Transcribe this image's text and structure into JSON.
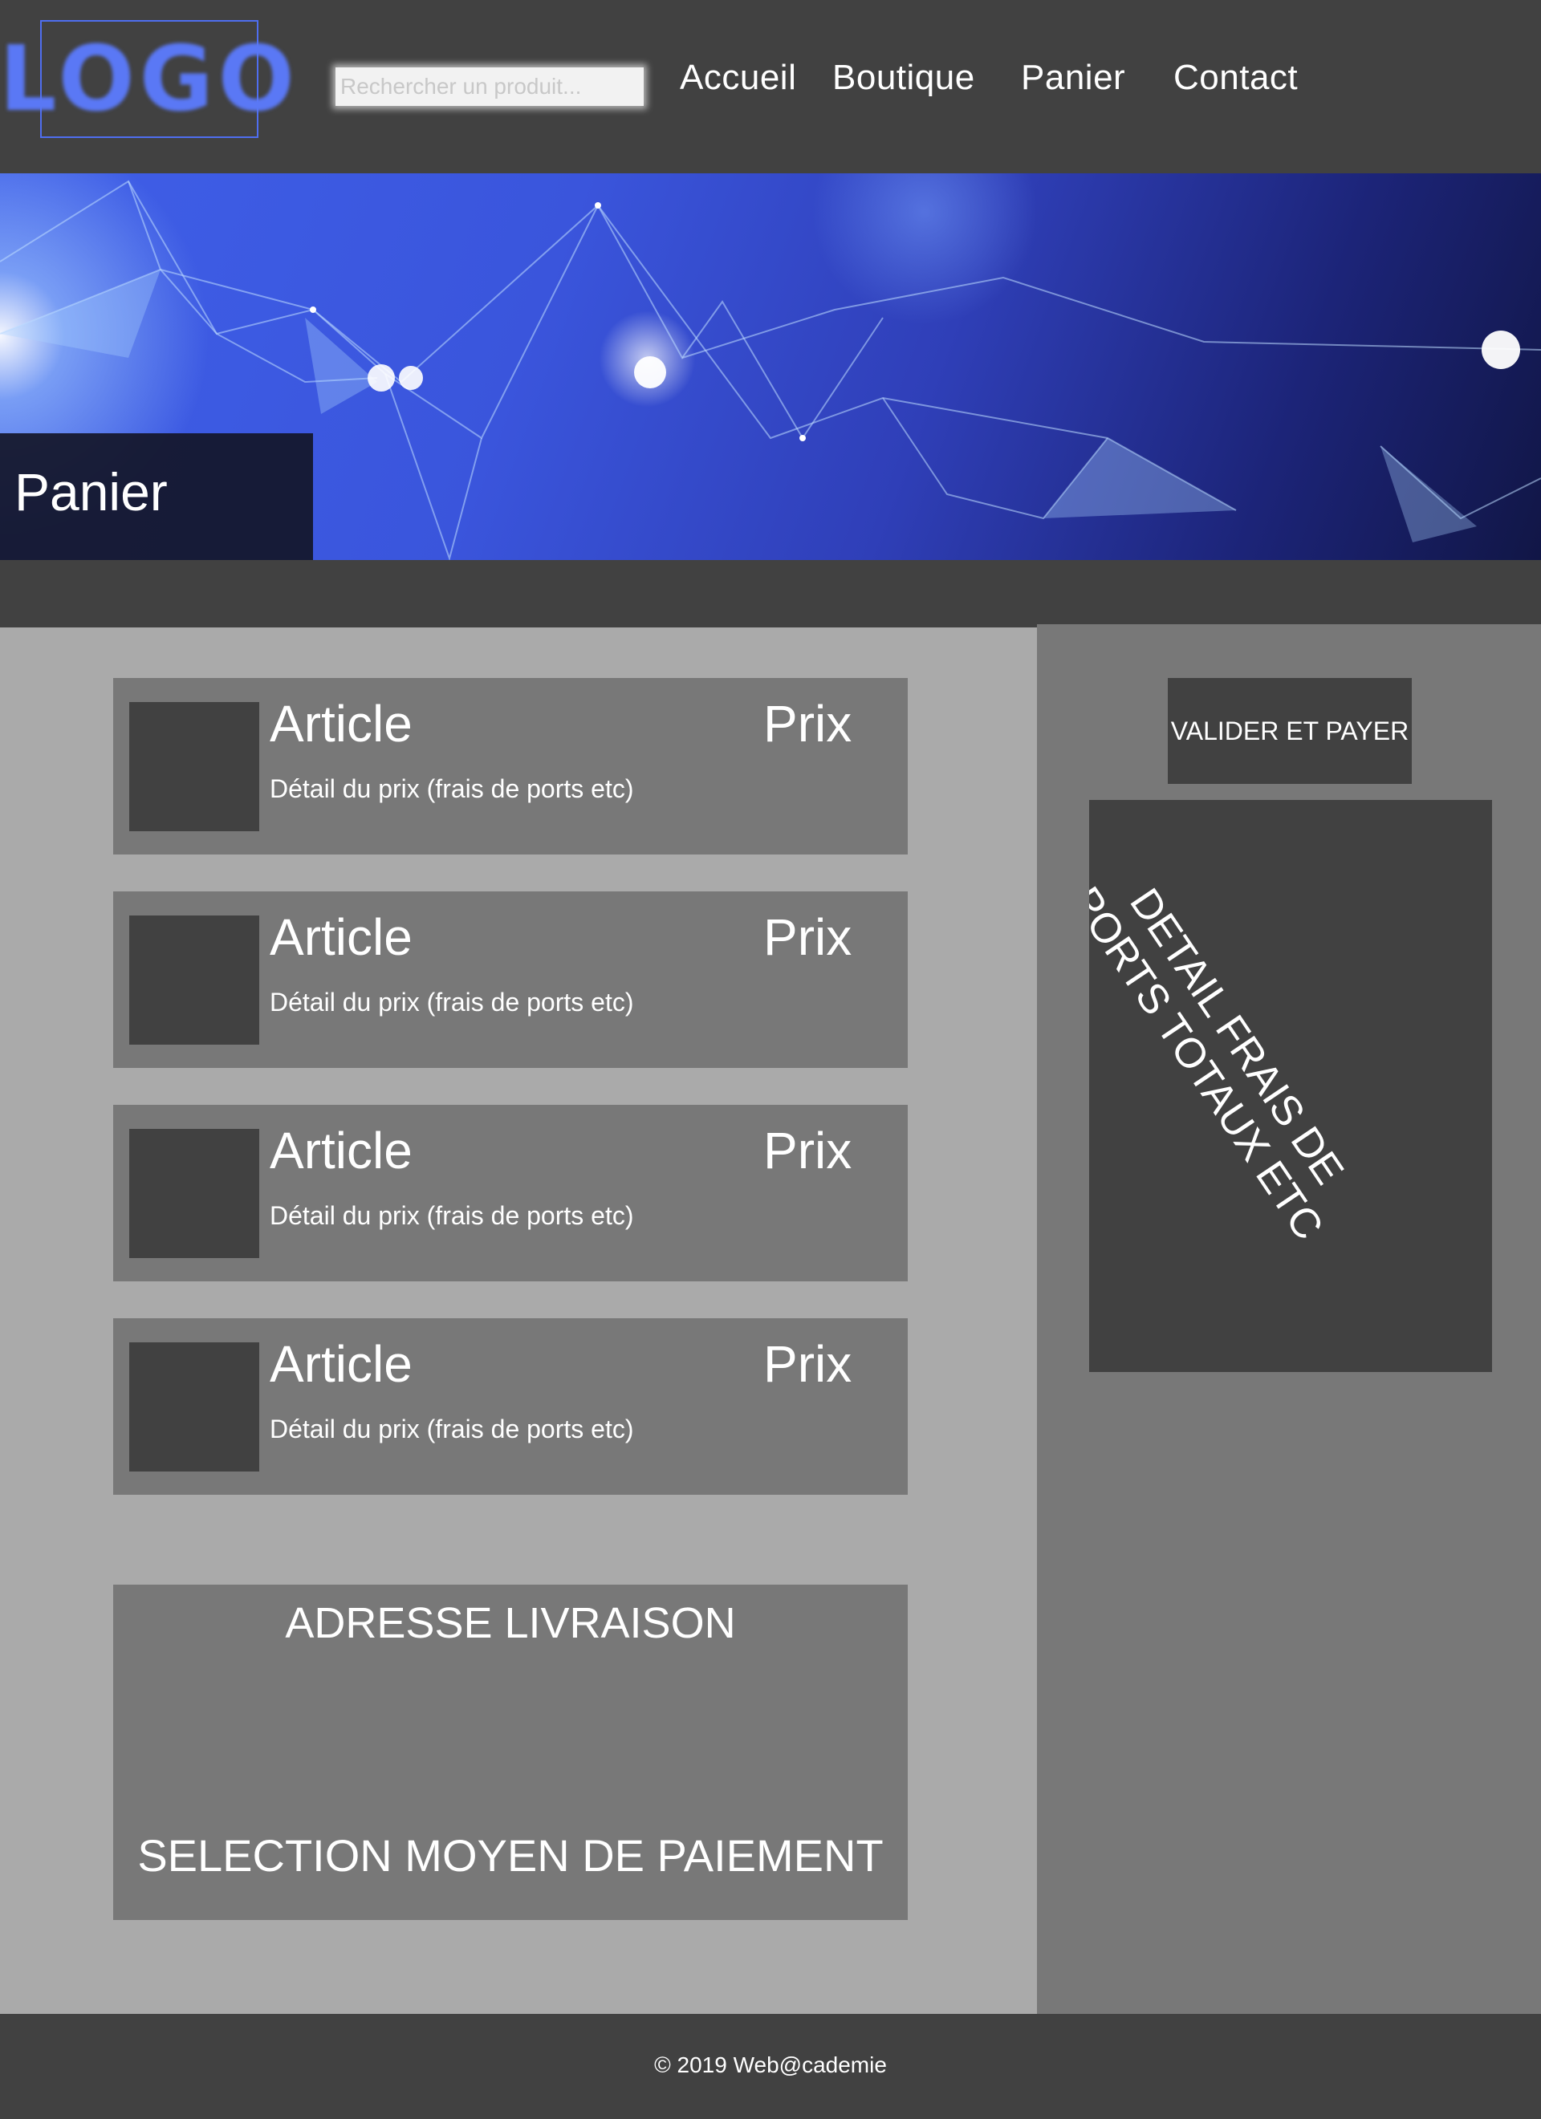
{
  "header": {
    "logo_text": "LOGO",
    "search_placeholder": "Rechercher un produit...",
    "nav": [
      "Accueil",
      "Boutique",
      "Panier",
      "Contact"
    ]
  },
  "hero": {
    "title": "Panier"
  },
  "cart": {
    "items": [
      {
        "title": "Article",
        "price": "Prix",
        "detail": "Détail du prix (frais de ports etc)"
      },
      {
        "title": "Article",
        "price": "Prix",
        "detail": "Détail du prix (frais de ports etc)"
      },
      {
        "title": "Article",
        "price": "Prix",
        "detail": "Détail du prix (frais de ports etc)"
      },
      {
        "title": "Article",
        "price": "Prix",
        "detail": "Détail du prix (frais de ports etc)"
      }
    ],
    "address_title": "ADRESSE LIVRAISON",
    "payment_title": "SELECTION MOYEN DE PAIEMENT"
  },
  "sidebar": {
    "pay_button": "VALIDER ET PAYER",
    "detail_text": "DETAIL FRAIS DE PORTS TOTAUX ETC"
  },
  "footer": {
    "copyright": "© 2019 Web@cademie"
  },
  "colors": {
    "dark": "#414141",
    "mid": "#787878",
    "light": "#aaaaaa",
    "logo_blue": "#5a78f5"
  }
}
